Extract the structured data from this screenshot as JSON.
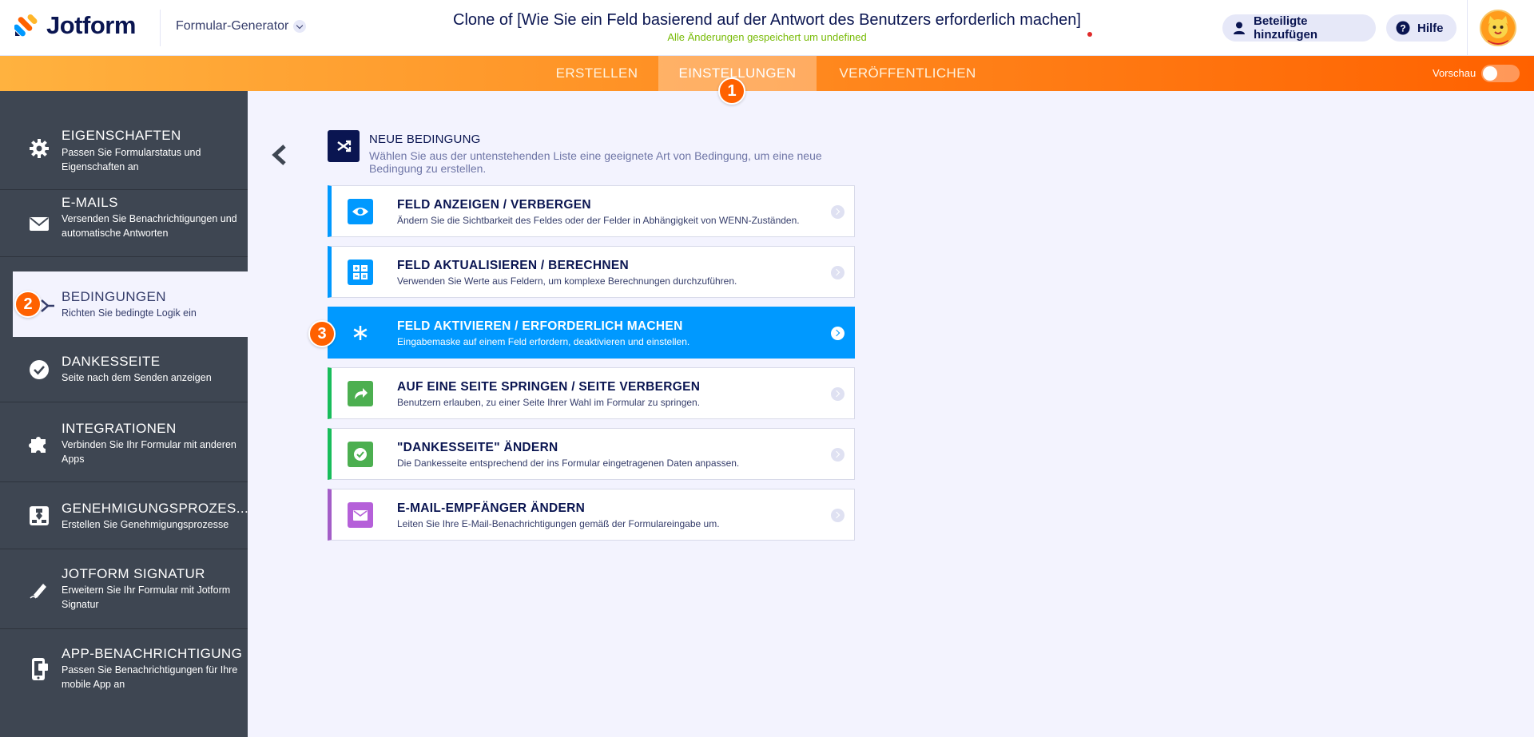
{
  "header": {
    "logo_text": "Jotform",
    "builder_label": "Formular-Generator",
    "form_title": "Clone of [Wie Sie ein Feld basierend auf der Antwort des Benutzers erforderlich machen]",
    "save_status": "Alle Änderungen gespeichert um undefined",
    "invite_label": "Beteiligte hinzufügen",
    "help_label": "Hilfe"
  },
  "nav": {
    "tabs": [
      "ERSTELLEN",
      "EINSTELLUNGEN",
      "VERÖFFENTLICHEN"
    ],
    "active_tab": "EINSTELLUNGEN",
    "preview_label": "Vorschau",
    "preview_on": false
  },
  "badges": [
    "1",
    "2",
    "3"
  ],
  "sidebar": {
    "items": [
      {
        "title": "EIGENSCHAFTEN",
        "desc": "Passen Sie Formularstatus und Eigenschaften an",
        "icon": "gear-icon"
      },
      {
        "title": "E-MAILS",
        "desc": "Versenden Sie Benachrichtigungen und automatische Antworten",
        "icon": "envelope-icon"
      },
      {
        "title": "BEDINGUNGEN",
        "desc": "Richten Sie bedingte Logik ein",
        "icon": "branch-icon",
        "active": true
      },
      {
        "title": "DANKESSEITE",
        "desc": "Seite nach dem Senden anzeigen",
        "icon": "check-circle-icon"
      },
      {
        "title": "INTEGRATIONEN",
        "desc": "Verbinden Sie Ihr Formular mit anderen Apps",
        "icon": "puzzle-icon"
      },
      {
        "title": "GENEHMIGUNGSPROZES...",
        "desc": "Erstellen Sie Genehmigungsprozesse",
        "icon": "flow-icon"
      },
      {
        "title": "JOTFORM SIGNATUR",
        "desc": "Erweitern Sie Ihr Formular mit Jotform Signatur",
        "icon": "pen-icon"
      },
      {
        "title": "APP-BENACHRICHTIGUNG",
        "desc": "Passen Sie Benachrichtigungen für Ihre mobile App an",
        "icon": "phone-icon"
      }
    ]
  },
  "main": {
    "new_condition_title": "NEUE BEDINGUNG",
    "new_condition_desc": "Wählen Sie aus der untenstehenden Liste eine geeignete Art von Bedingung, um eine neue Bedingung zu erstellen.",
    "conditions": [
      {
        "title": "FELD ANZEIGEN / VERBERGEN",
        "desc": "Ändern Sie die Sichtbarkeit des Feldes oder der Felder in Abhängigkeit von WENN-Zuständen.",
        "color": "#0099ff",
        "icon": "eye-icon"
      },
      {
        "title": "FELD AKTUALISIEREN / BERECHNEN",
        "desc": "Verwenden Sie Werte aus Feldern, um komplexe Berechnungen durchzuführen.",
        "color": "#0099ff",
        "icon": "calculator-icon"
      },
      {
        "title": "FELD AKTIVIEREN / ERFORDERLICH MACHEN",
        "desc": "Eingabemaske auf einem Feld erfordern, deaktivieren und einstellen.",
        "color": "#0099ff",
        "icon": "asterisk-icon",
        "selected": true
      },
      {
        "title": "AUF EINE SEITE SPRINGEN / SEITE VERBERGEN",
        "desc": "Benutzern erlauben, zu einer Seite Ihrer Wahl im Formular zu springen.",
        "color": "#18bd5b",
        "icon": "jump-arrow-icon"
      },
      {
        "title": "\"DANKESSEITE\" ÄNDERN",
        "desc": "Die Dankesseite entsprechend der ins Formular eingetragenen Daten anpassen.",
        "color": "#18bd5b",
        "icon": "check-icon"
      },
      {
        "title": "E-MAIL-EMPFÄNGER ÄNDERN",
        "desc": "Leiten Sie Ihre E-Mail-Benachrichtigungen gemäß der Formulareingabe um.",
        "color": "#a35dc7",
        "icon": "mail-icon"
      }
    ]
  }
}
